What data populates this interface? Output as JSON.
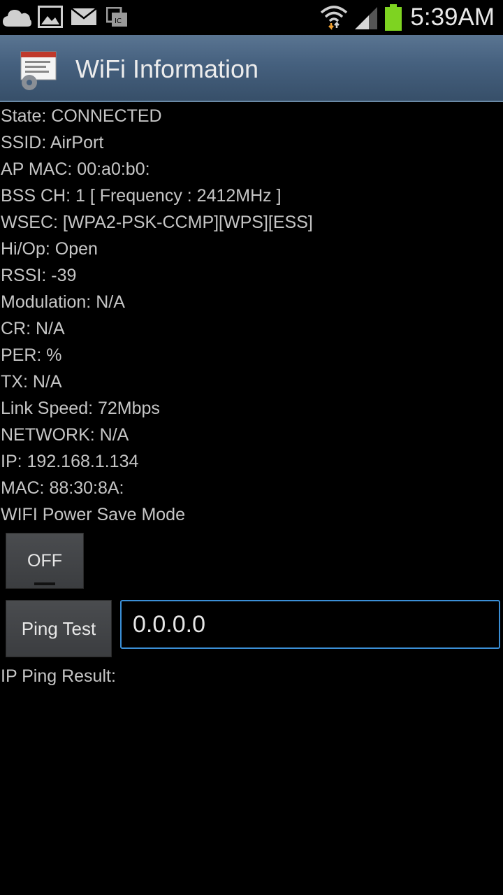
{
  "status_bar": {
    "time": "5:39AM",
    "icons": [
      "cloud-icon",
      "gallery-icon",
      "mail-icon",
      "ic-icon",
      "wifi-icon",
      "signal-icon",
      "battery-icon"
    ]
  },
  "action_bar": {
    "title": "WiFi Information"
  },
  "info": {
    "lines": [
      "State: CONNECTED",
      "SSID: AirPort",
      "AP MAC: 00:a0:b0:",
      "BSS CH: 1  [ Frequency : 2412MHz ]",
      "WSEC: [WPA2-PSK-CCMP][WPS][ESS]",
      "Hi/Op: Open",
      "RSSI: -39",
      "Modulation: N/A",
      "CR: N/A",
      "PER:  %",
      "TX: N/A",
      "Link Speed: 72Mbps",
      "NETWORK: N/A",
      "IP: 192.168.1.134",
      "MAC: 88:30:8A:",
      "WIFI Power Save Mode"
    ]
  },
  "power_save": {
    "toggle_label": "OFF"
  },
  "ping": {
    "button_label": "Ping Test",
    "input_value": "0.0.0.0",
    "result_label": "IP Ping Result:"
  },
  "colors": {
    "accent": "#3b8fd6",
    "battery": "#7ed321",
    "wifi_arrow": "#f0a030"
  }
}
